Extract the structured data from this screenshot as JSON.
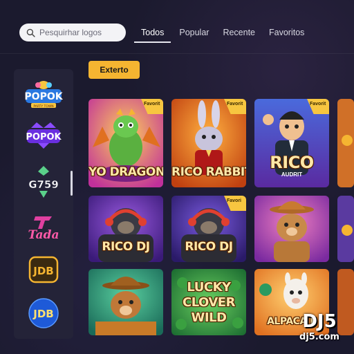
{
  "search": {
    "placeholder": "Pesquirhar logos"
  },
  "tabs": [
    {
      "label": "Todos",
      "active": true
    },
    {
      "label": "Popular",
      "active": false
    },
    {
      "label": "Recente",
      "active": false
    },
    {
      "label": "Favoritos",
      "active": false
    }
  ],
  "sidebar": {
    "providers": [
      {
        "logo": "popok-party-town-logo",
        "label": "POPOK",
        "sub": "PARTY TOWN"
      },
      {
        "logo": "popok-logo",
        "label": "POPOK"
      },
      {
        "logo": "g759-logo",
        "label": "G759"
      },
      {
        "logo": "tada-logo",
        "label": "Tada"
      },
      {
        "logo": "jdb-logo",
        "label": "JDB"
      },
      {
        "logo": "jdb-round-logo",
        "label": "JDB"
      }
    ]
  },
  "category_button": {
    "label": "Exterto"
  },
  "games": [
    {
      "title": "YO DRAGON",
      "badge": "Favorit"
    },
    {
      "title": "RICO RABBIT",
      "badge": "Favorit"
    },
    {
      "title": "RICO",
      "subtitle": "AUDRIT",
      "badge": "Favorit"
    },
    {
      "title": "RICO DJ",
      "badge": ""
    },
    {
      "title": "RICO DJ",
      "badge": "Favori"
    },
    {
      "title": "",
      "badge": ""
    },
    {
      "title": "",
      "badge": ""
    },
    {
      "title": "LUCKY CLOVER WILD",
      "badge": ""
    },
    {
      "title": "ALPACA P",
      "badge": ""
    }
  ],
  "watermark": {
    "big": "DJ5",
    "small": "dj5.com"
  },
  "colors": {
    "accent": "#f5b531",
    "sidebar": "#242338",
    "background": "#1b1a2e"
  }
}
